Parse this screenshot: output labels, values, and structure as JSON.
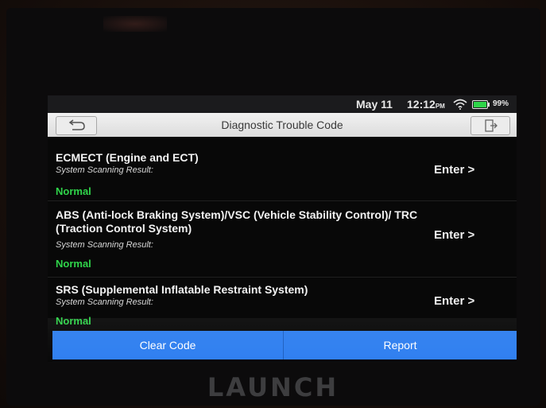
{
  "status_bar": {
    "date": "May 11",
    "time": "12:12",
    "ampm": "PM",
    "battery": "99%"
  },
  "title_bar": {
    "title": "Diagnostic Trouble Code",
    "back_icon": "back-arrow-icon",
    "exit_icon": "exit-icon"
  },
  "systems": [
    {
      "name": "ECMECT (Engine and ECT)",
      "result_label": "System Scanning Result:",
      "result": "Normal",
      "enter": "Enter >"
    },
    {
      "name": "ABS (Anti-lock Braking System)/VSC (Vehicle Stability Control)/ TRC (Traction Control System)",
      "result_label": "System Scanning Result:",
      "result": "Normal",
      "enter": "Enter >"
    },
    {
      "name": "SRS (Supplemental Inflatable Restraint System)",
      "result_label": "System Scanning Result:",
      "result": "Normal",
      "enter": "Enter >"
    }
  ],
  "actions": {
    "clear_code": "Clear Code",
    "report": "Report"
  },
  "device": {
    "brand": "LAUNCH"
  },
  "colors": {
    "accent": "#2f7ff0",
    "normal_status": "#2fd44a"
  }
}
